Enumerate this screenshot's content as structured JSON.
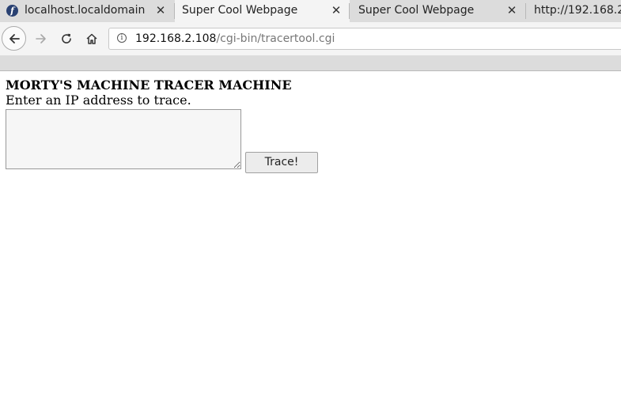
{
  "browser": {
    "tabs": [
      {
        "label": "localhost.localdomain",
        "has_favicon": true,
        "favicon": "fedora-icon"
      },
      {
        "label": "Super Cool Webpage",
        "selected": true
      },
      {
        "label": "Super Cool Webpage"
      },
      {
        "label": "http://192.168.2."
      }
    ],
    "close_glyph": "✕",
    "url": {
      "host": "192.168.2.108",
      "path": "/cgi-bin/tracertool.cgi"
    },
    "nav_icons": [
      "back-arrow-icon",
      "forward-arrow-icon",
      "reload-icon",
      "home-icon",
      "info-icon"
    ]
  },
  "page": {
    "heading": "MORTY'S MACHINE TRACER MACHINE",
    "instructions": "Enter an IP address to trace.",
    "ip_input_value": "",
    "trace_button_label": "Trace!"
  }
}
